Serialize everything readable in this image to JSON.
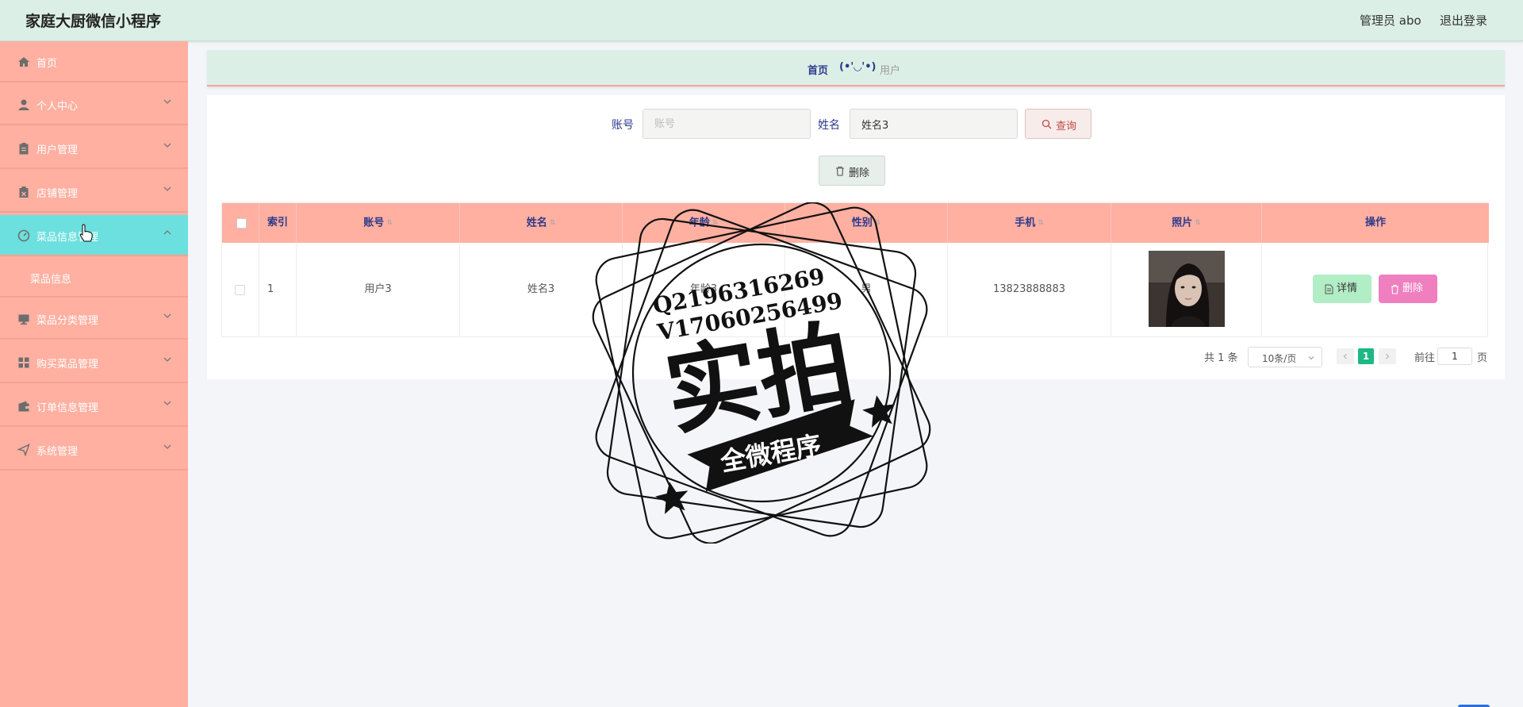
{
  "header": {
    "title": "家庭大厨微信小程序",
    "admin": "管理员 abo",
    "logout": "退出登录"
  },
  "sidebar": {
    "items": [
      {
        "label": "首页",
        "icon": "home-icon"
      },
      {
        "label": "个人中心",
        "icon": "user-icon"
      },
      {
        "label": "用户管理",
        "icon": "clipboard-icon"
      },
      {
        "label": "店铺管理",
        "icon": "store-icon"
      },
      {
        "label": "菜品信息管理",
        "icon": "gauge-icon",
        "active": true
      },
      {
        "label": "菜品分类管理",
        "icon": "monitor-icon"
      },
      {
        "label": "购买菜品管理",
        "icon": "grid-icon"
      },
      {
        "label": "订单信息管理",
        "icon": "wallet-icon"
      },
      {
        "label": "系统管理",
        "icon": "send-icon"
      }
    ],
    "sub_item": "菜品信息"
  },
  "breadcrumb": {
    "home": "首页",
    "separator": "(•'◡'•)",
    "current": "用户"
  },
  "search": {
    "account_label": "账号",
    "account_placeholder": "账号",
    "account_value": "",
    "name_label": "姓名",
    "name_value": "姓名3",
    "query_button": "查询",
    "delete_button": "删除"
  },
  "table": {
    "columns": [
      "索引",
      "账号",
      "姓名",
      "年龄",
      "性别",
      "手机",
      "照片",
      "操作"
    ],
    "rows": [
      {
        "index": "1",
        "account": "用户3",
        "name": "姓名3",
        "age": "年龄3",
        "gender": "男",
        "phone": "13823888883",
        "detail": "详情",
        "delete": "删除"
      }
    ]
  },
  "pagination": {
    "total": "共 1 条",
    "page_size": "10条/页",
    "current": "1",
    "goto_label": "前往",
    "goto_value": "1",
    "unit": "页"
  },
  "watermark": {
    "line1": "Q2196316269",
    "line2": "V17060256499",
    "big": "实拍",
    "ribbon": "全微程序"
  },
  "colors": {
    "header_bg": "#dcefe6",
    "sidebar_bg": "#ffb0a1",
    "sidebar_active": "#6ce0de",
    "table_header_bg": "#ffb0a1",
    "accent_text": "#2c3a8c",
    "detail_button": "#b1edc5",
    "delete_button": "#ef7fbf",
    "pager_active": "#1db884"
  }
}
